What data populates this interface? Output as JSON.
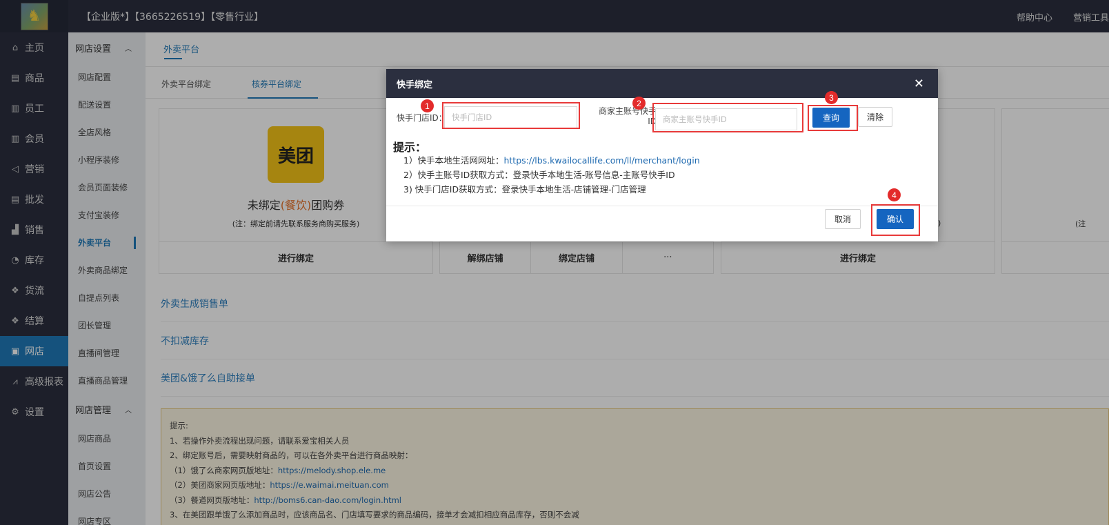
{
  "topbar": {
    "title": "【企业版*】【3665226519】【零售行业】",
    "help": "帮助中心",
    "tools": "营销工具"
  },
  "leftnav": [
    {
      "label": "主页",
      "icon": "home-icon",
      "glyph": "⌂"
    },
    {
      "label": "商品",
      "icon": "box-icon",
      "glyph": "▤"
    },
    {
      "label": "员工",
      "icon": "staff-icon",
      "glyph": "▥"
    },
    {
      "label": "会员",
      "icon": "member-icon",
      "glyph": "▥"
    },
    {
      "label": "营销",
      "icon": "megaphone-icon",
      "glyph": "◁"
    },
    {
      "label": "批发",
      "icon": "wholesale-icon",
      "glyph": "▤"
    },
    {
      "label": "销售",
      "icon": "sales-chart-icon",
      "glyph": "▟"
    },
    {
      "label": "库存",
      "icon": "pie-chart-icon",
      "glyph": "◔"
    },
    {
      "label": "货流",
      "icon": "cube-icon",
      "glyph": "❖"
    },
    {
      "label": "结算",
      "icon": "settle-icon",
      "glyph": "❖"
    },
    {
      "label": "网店",
      "icon": "gift-icon",
      "glyph": "▣"
    },
    {
      "label": "高级报表",
      "icon": "line-chart-icon",
      "glyph": "⩘"
    },
    {
      "label": "设置",
      "icon": "gear-icon",
      "glyph": "⚙"
    }
  ],
  "subnav": {
    "group1": "网店设置",
    "items1": [
      "网店配置",
      "配送设置",
      "全店风格",
      "小程序装修",
      "会员页面装修",
      "支付宝装修",
      "外卖平台",
      "外卖商品绑定",
      "自提点列表",
      "团长管理",
      "直播间管理",
      "直播商品管理"
    ],
    "group2": "网店管理",
    "items2": [
      "网店商品",
      "首页设置",
      "网店公告",
      "网店专区"
    ]
  },
  "main": {
    "top_tab": "外卖平台",
    "tabs": [
      "外卖平台绑定",
      "核券平台绑定"
    ],
    "card1": {
      "logo_text": "美团",
      "title_pre": "未绑定",
      "title_tag": "(餐饮)",
      "title_post": "团购券",
      "note": "(注：绑定前请先联系服务商购买服务)",
      "action": "进行绑定"
    },
    "card2": {
      "actions": [
        "解绑店铺",
        "绑定店铺",
        "···"
      ]
    },
    "card3": {
      "note_tail": "务)",
      "action": "进行绑定"
    },
    "card4": {
      "note_head": "(注"
    },
    "links": [
      "外卖生成销售单",
      "不扣减库存",
      "美团&饿了么自助接单"
    ],
    "tips": {
      "title": "提示:",
      "l1": "1、若操作外卖流程出现问题，请联系爱宝相关人员",
      "l2": "2、绑定账号后，需要映射商品的，可以在各外卖平台进行商品映射：",
      "l3_pre": "（1）饿了么商家网页版地址：",
      "l3_link": "https://melody.shop.ele.me",
      "l4_pre": "（2）美团商家网页版地址：",
      "l4_link": "https://e.waimai.meituan.com",
      "l5_pre": "（3）餐道网页版地址：",
      "l5_link": "http://boms6.can-dao.com/login.html",
      "l6": "3、在美团跟单饿了么添加商品时，应该商品名、门店填写要求的商品编码，接单才会减扣相应商品库存，否则不会减"
    }
  },
  "modal": {
    "title": "快手绑定",
    "store_label": "快手门店ID：",
    "store_placeholder": "快手门店ID",
    "account_label_1": "商家主账号快手",
    "account_label_2": "ID",
    "account_placeholder": "商家主账号快手ID",
    "query": "查询",
    "clear": "清除",
    "hint_title": "提示：",
    "hint1_pre": "1）快手本地生活网网址：",
    "hint1_link": "https://lbs.kwailocallife.com/ll/merchant/login",
    "hint2": "2）快手主账号ID获取方式：登录快手本地生活-账号信息-主账号快手ID",
    "hint3": "3) 快手门店ID获取方式：登录快手本地生活-店铺管理-门店管理",
    "cancel": "取消",
    "confirm": "确认",
    "badges": [
      "1",
      "2",
      "3",
      "4"
    ],
    "annotation_color": "#e83a3a"
  }
}
